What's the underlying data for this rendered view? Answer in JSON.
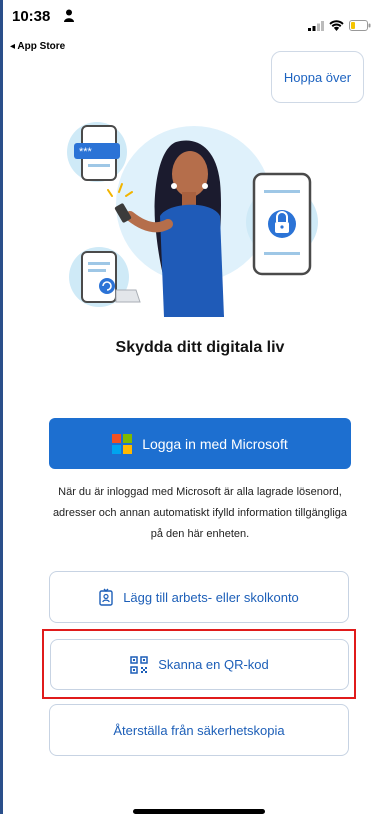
{
  "status_bar": {
    "time": "10:38",
    "back_label": "◂ App Store"
  },
  "skip_button": {
    "label": "Hoppa över"
  },
  "title": "Skydda ditt digitala liv",
  "primary_button": {
    "label": "Logga in med Microsoft"
  },
  "description": "När du är inloggad med Microsoft är alla lagrade lösenord, adresser och annan automatiskt ifylld information tillgängliga på den här enheten.",
  "buttons": {
    "work_account": "Lägg till arbets- eller skolkonto",
    "scan_qr": "Skanna en QR-kod",
    "restore": "Återställa från säkerhetskopia"
  },
  "colors": {
    "accent": "#1d6fd0",
    "link": "#1d5fb8",
    "highlight": "#e01b1b",
    "ms_red": "#f25022",
    "ms_green": "#7fba00",
    "ms_blue": "#00a4ef",
    "ms_yellow": "#ffb900"
  }
}
